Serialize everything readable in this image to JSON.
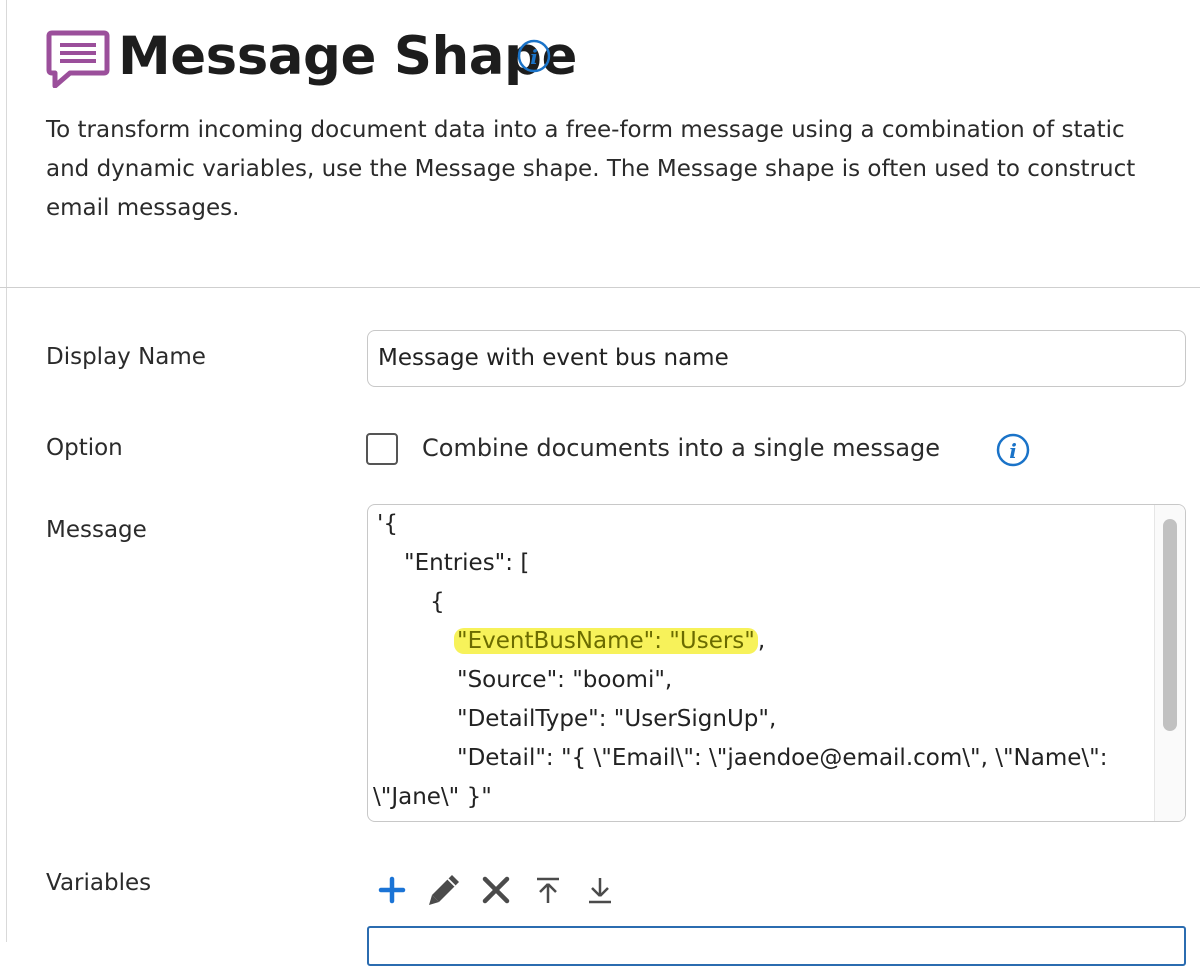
{
  "header": {
    "title": "Message Shape",
    "icon": "message-shape-icon",
    "info_icon": "info-icon",
    "description_lines": [
      "To transform incoming document data into a free-form message using a combination of static",
      "and dynamic variables, use the Message shape. The Message shape is often used to construct",
      "email messages."
    ]
  },
  "form": {
    "display_name": {
      "label": "Display Name",
      "value": "Message with event bus name"
    },
    "option": {
      "label": "Option",
      "checkbox_label": "Combine documents into a single message",
      "checked": false
    },
    "message": {
      "label": "Message",
      "lines": [
        "'{",
        "\"Entries\": [",
        "{",
        "\"EventBusName\": \"Users\"",
        "\"Source\": \"boomi\",",
        "\"DetailType\": \"UserSignUp\",",
        "\"Detail\": \"{ \\\"Email\\\": \\\"jaendoe@email.com\\\", \\\"Name\\\":",
        "\\\"Jane\\\" }\""
      ],
      "line_4_suffix": ","
    },
    "variables": {
      "label": "Variables",
      "toolbar": [
        "add-icon",
        "edit-icon",
        "delete-icon",
        "move-top-icon",
        "move-bottom-icon"
      ]
    }
  },
  "colors": {
    "accent_purple": "#9b4f9b",
    "info_blue": "#1a73c8",
    "add_blue": "#1b74d6",
    "highlight": "#f7f25a",
    "table_border": "#2b6cb0"
  }
}
